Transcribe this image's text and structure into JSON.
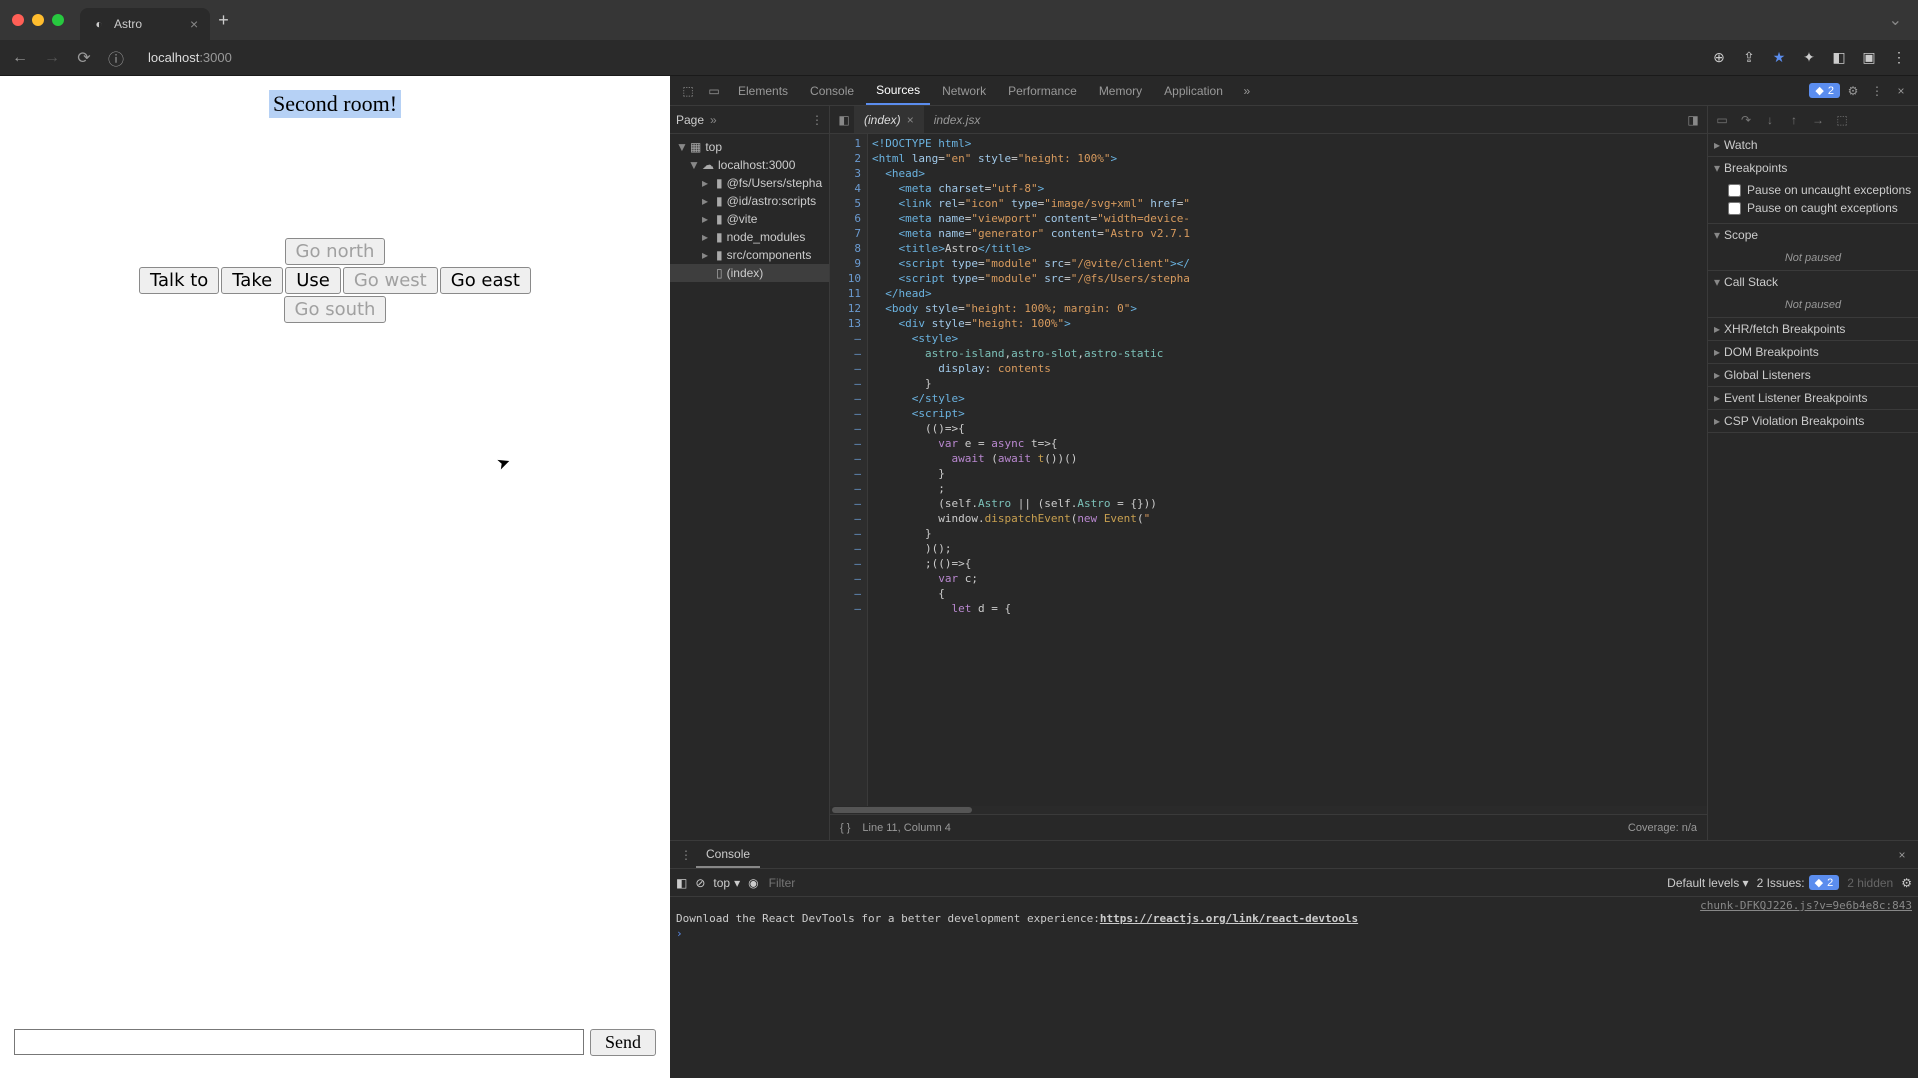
{
  "browser": {
    "tab_title": "Astro",
    "url_host": "localhost",
    "url_port": ":3000"
  },
  "game": {
    "room_title": "Second room!",
    "talk_to": "Talk to",
    "take": "Take",
    "use": "Use",
    "go_north": "Go north",
    "go_west": "Go west",
    "go_east": "Go east",
    "go_south": "Go south",
    "send": "Send",
    "input_value": ""
  },
  "devtools": {
    "tabs": {
      "elements": "Elements",
      "console": "Console",
      "sources": "Sources",
      "network": "Network",
      "performance": "Performance",
      "memory": "Memory",
      "application": "Application"
    },
    "issue_count": "2",
    "nav": {
      "page": "Page",
      "tree": {
        "top": "top",
        "host": "localhost:3000",
        "path1": "@fs/Users/stepha",
        "path2": "@id/astro:scripts",
        "path3": "@vite",
        "path4": "node_modules",
        "path5": "src/components",
        "index": "(index)"
      }
    },
    "editor": {
      "tab1": "(index)",
      "tab2": "index.jsx",
      "status_line": "Line 11, Column 4",
      "coverage": "Coverage: n/a"
    },
    "code": {
      "gutter": "1\n2\n3\n4\n5\n6\n7\n8\n9\n10\n11\n12\n13\n–\n–\n–\n–\n–\n–\n–\n–\n–\n–\n–\n–\n–\n–\n–\n–\n–\n–\n–"
    },
    "sidebar": {
      "watch": "Watch",
      "breakpoints": "Breakpoints",
      "pause_uncaught": "Pause on uncaught exceptions",
      "pause_caught": "Pause on caught exceptions",
      "scope": "Scope",
      "not_paused": "Not paused",
      "call_stack": "Call Stack",
      "xhr": "XHR/fetch Breakpoints",
      "dom": "DOM Breakpoints",
      "global": "Global Listeners",
      "event": "Event Listener Breakpoints",
      "csp": "CSP Violation Breakpoints"
    }
  },
  "console": {
    "title": "Console",
    "context": "top",
    "filter_placeholder": "Filter",
    "levels": "Default levels",
    "issues_label": "2 Issues:",
    "issues_count": "2",
    "hidden": "2 hidden",
    "source": "chunk-DFKQJ226.js?v=9e6b4e8c:843",
    "message": "Download the React DevTools for a better development experience: ",
    "link": "https://reactjs.org/link/react-devtools"
  }
}
